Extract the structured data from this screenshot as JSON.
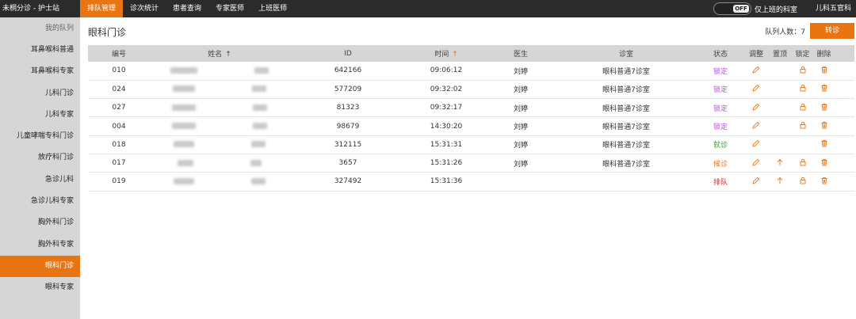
{
  "app": {
    "title": "未桐分诊 - 护士站"
  },
  "nav": {
    "tabs": [
      {
        "label": "排队管理",
        "active": true
      },
      {
        "label": "诊次统计",
        "active": false
      },
      {
        "label": "患者查询",
        "active": false
      },
      {
        "label": "专家医师",
        "active": false
      },
      {
        "label": "上班医师",
        "active": false
      }
    ]
  },
  "toggle": {
    "state": "OFF",
    "label": "仅上班的科室"
  },
  "dept": {
    "name": "儿科五官科"
  },
  "sidebar": {
    "header": "我的队列",
    "items": [
      {
        "label": "耳鼻喉科普通",
        "active": false
      },
      {
        "label": "耳鼻喉科专家",
        "active": false
      },
      {
        "label": "儿科门诊",
        "active": false
      },
      {
        "label": "儿科专家",
        "active": false
      },
      {
        "label": "儿童哮喘专科门诊",
        "active": false
      },
      {
        "label": "放疗科门诊",
        "active": false
      },
      {
        "label": "急诊儿科",
        "active": false
      },
      {
        "label": "急诊儿科专家",
        "active": false
      },
      {
        "label": "胸外科门诊",
        "active": false
      },
      {
        "label": "胸外科专家",
        "active": false
      },
      {
        "label": "眼科门诊",
        "active": true
      },
      {
        "label": "眼科专家",
        "active": false
      }
    ]
  },
  "main": {
    "title": "眼科门诊",
    "queue_count": "队列人数：7",
    "transfer_label": "转诊",
    "columns": {
      "num": "编号",
      "name": "姓名",
      "id": "ID",
      "time": "时间",
      "doctor": "医生",
      "room": "诊室",
      "status": "状态",
      "adjust": "调整",
      "top": "置顶",
      "lock": "锁定",
      "delete": "删除"
    },
    "rows": [
      {
        "num": "010",
        "id": "642166",
        "time": "09:06:12",
        "doctor": "刘婷",
        "room": "眼科普通7诊室",
        "status": "锁定",
        "status_class": "st-lock",
        "has_top": false,
        "has_lock": true
      },
      {
        "num": "024",
        "id": "577209",
        "time": "09:32:02",
        "doctor": "刘婷",
        "room": "眼科普通7诊室",
        "status": "锁定",
        "status_class": "st-lock",
        "has_top": false,
        "has_lock": true
      },
      {
        "num": "027",
        "id": "81323",
        "time": "09:32:17",
        "doctor": "刘婷",
        "room": "眼科普通7诊室",
        "status": "锁定",
        "status_class": "st-lock",
        "has_top": false,
        "has_lock": true
      },
      {
        "num": "004",
        "id": "98679",
        "time": "14:30:20",
        "doctor": "刘婷",
        "room": "眼科普通7诊室",
        "status": "锁定",
        "status_class": "st-lock",
        "has_top": false,
        "has_lock": true
      },
      {
        "num": "018",
        "id": "312115",
        "time": "15:31:31",
        "doctor": "刘婷",
        "room": "眼科普通7诊室",
        "status": "就诊",
        "status_class": "st-visit",
        "has_top": false,
        "has_lock": false
      },
      {
        "num": "017",
        "id": "3657",
        "time": "15:31:26",
        "doctor": "刘婷",
        "room": "眼科普通7诊室",
        "status": "候诊",
        "status_class": "st-wait",
        "has_top": true,
        "has_lock": true
      },
      {
        "num": "019",
        "id": "327492",
        "time": "15:31:36",
        "doctor": "",
        "room": "",
        "status": "排队",
        "status_class": "st-queue",
        "has_top": true,
        "has_lock": true
      }
    ]
  },
  "colors": {
    "accent": "#e87511",
    "topbar": "#2b2b2b",
    "sidebar": "#d6d6d6",
    "locked": "#b455d9",
    "visiting": "#33a033",
    "waiting": "#e87511",
    "queued": "#e02424"
  },
  "icons": {
    "adjust": "pencil-icon",
    "top": "arrow-up-icon",
    "lock": "lock-icon",
    "delete": "trash-icon"
  }
}
